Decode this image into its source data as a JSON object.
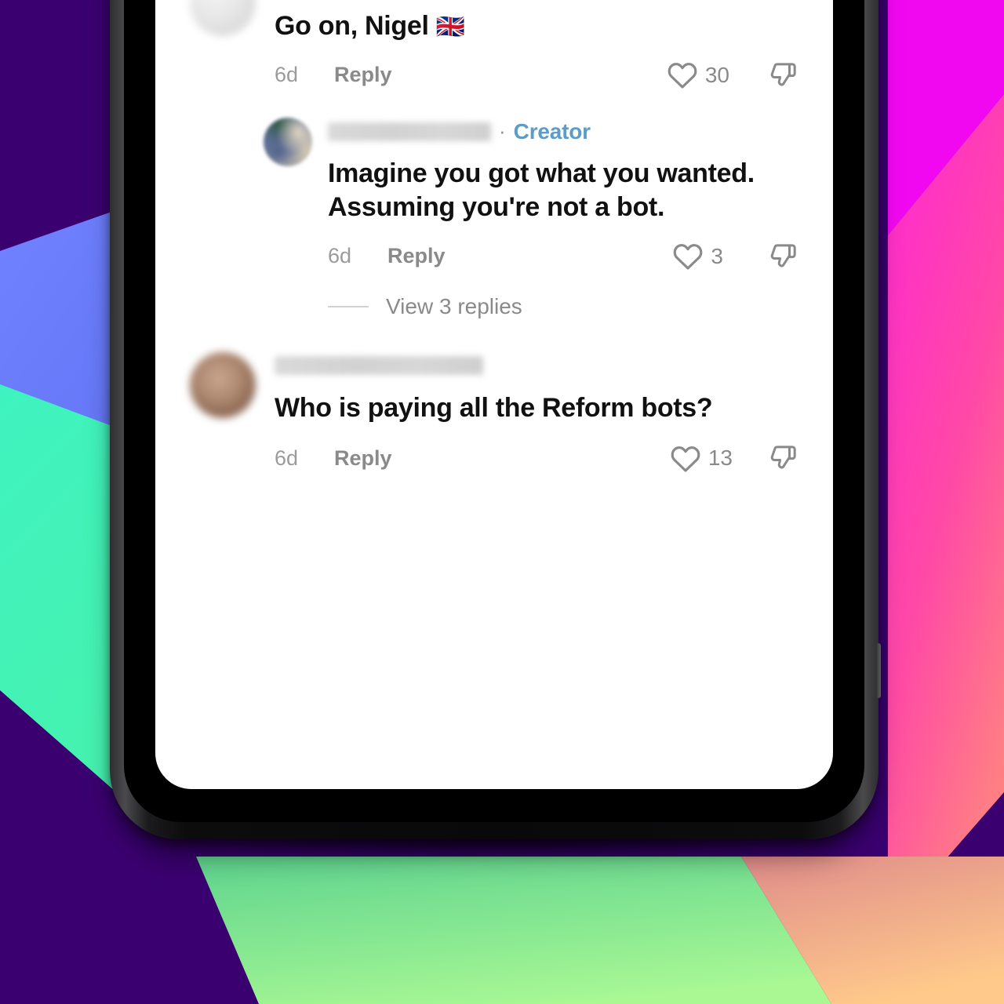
{
  "app": {
    "platform": "tiktok-comments",
    "screen_background": "#ffffff"
  },
  "colors": {
    "creator_badge": "#5d9cc6",
    "meta_text": "#8a8a8a",
    "comment_text": "#111111",
    "bezel": "#0a0a0b",
    "bg_purple": "#3a0070",
    "bg_magenta": "#f01ef0",
    "bg_pink": "#ff4fb0",
    "bg_blue": "#6b7bf7",
    "bg_mint": "#3ef0b8",
    "bg_green": "#8ef08a",
    "bg_orange": "#ffbe82"
  },
  "comments": [
    {
      "id": "c1",
      "username_redacted": true,
      "avatar": "gray-blurred-avatar",
      "text": "Go on, Nigel",
      "emoji": "🇬🇧",
      "time": "6d",
      "reply_label": "Reply",
      "like_count": "30",
      "like_icon": "heart-outline-icon",
      "dislike_icon": "thumbs-down-outline-icon",
      "is_creator": false,
      "has_dislike": true
    },
    {
      "id": "c2",
      "username_redacted": true,
      "avatar": "creator-blurred-avatar",
      "badge": "Creator",
      "separator": "·",
      "text": "Imagine you got what you wanted. Assuming you're not a bot.",
      "line1": "Imagine you got what you wanted.",
      "line2": "Assuming you're not a bot.",
      "time": "6d",
      "reply_label": "Reply",
      "like_count": "3",
      "like_icon": "heart-outline-icon",
      "dislike_icon": "thumbs-down-outline-icon",
      "is_creator": true,
      "has_dislike": true,
      "view_replies_label": "View 3 replies",
      "reply_count": 3
    },
    {
      "id": "c3",
      "username_redacted": true,
      "avatar": "brown-blurred-avatar",
      "text": "Who is paying all the Reform bots?",
      "time": "6d",
      "reply_label": "Reply",
      "like_count": "13",
      "like_icon": "heart-outline-icon",
      "dislike_icon": "thumbs-down-outline-icon",
      "is_creator": false,
      "has_dislike": true
    }
  ]
}
